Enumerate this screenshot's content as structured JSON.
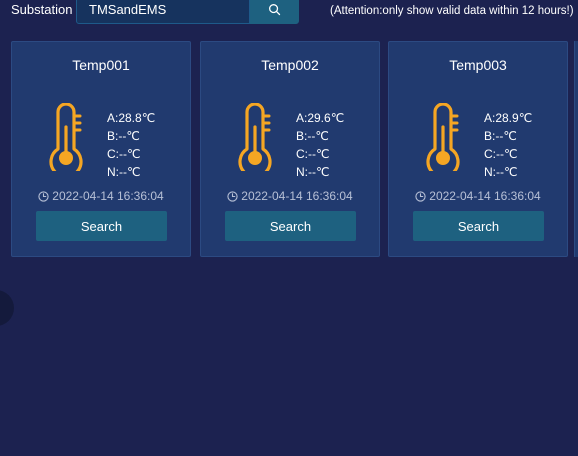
{
  "toolbar": {
    "substation_label": "Substation",
    "substation_value": "TMSandEMS",
    "attention": "(Attention:only show valid data within 12 hours!)"
  },
  "icons": {
    "search": "search-icon",
    "clock": "clock-icon",
    "thermometer": "thermometer-icon"
  },
  "colors": {
    "background": "#1c2250",
    "card": "#213a6f",
    "accent_button": "#1e6180",
    "thermometer": "#f5a623"
  },
  "cards": [
    {
      "title": "Temp001",
      "a": "A:28.8℃",
      "b": "B:--℃",
      "c": "C:--℃",
      "n": "N:--℃",
      "timestamp": "2022-04-14 16:36:04",
      "button": "Search"
    },
    {
      "title": "Temp002",
      "a": "A:29.6℃",
      "b": "B:--℃",
      "c": "C:--℃",
      "n": "N:--℃",
      "timestamp": "2022-04-14 16:36:04",
      "button": "Search"
    },
    {
      "title": "Temp003",
      "a": "A:28.9℃",
      "b": "B:--℃",
      "c": "C:--℃",
      "n": "N:--℃",
      "timestamp": "2022-04-14 16:36:04",
      "button": "Search"
    }
  ]
}
